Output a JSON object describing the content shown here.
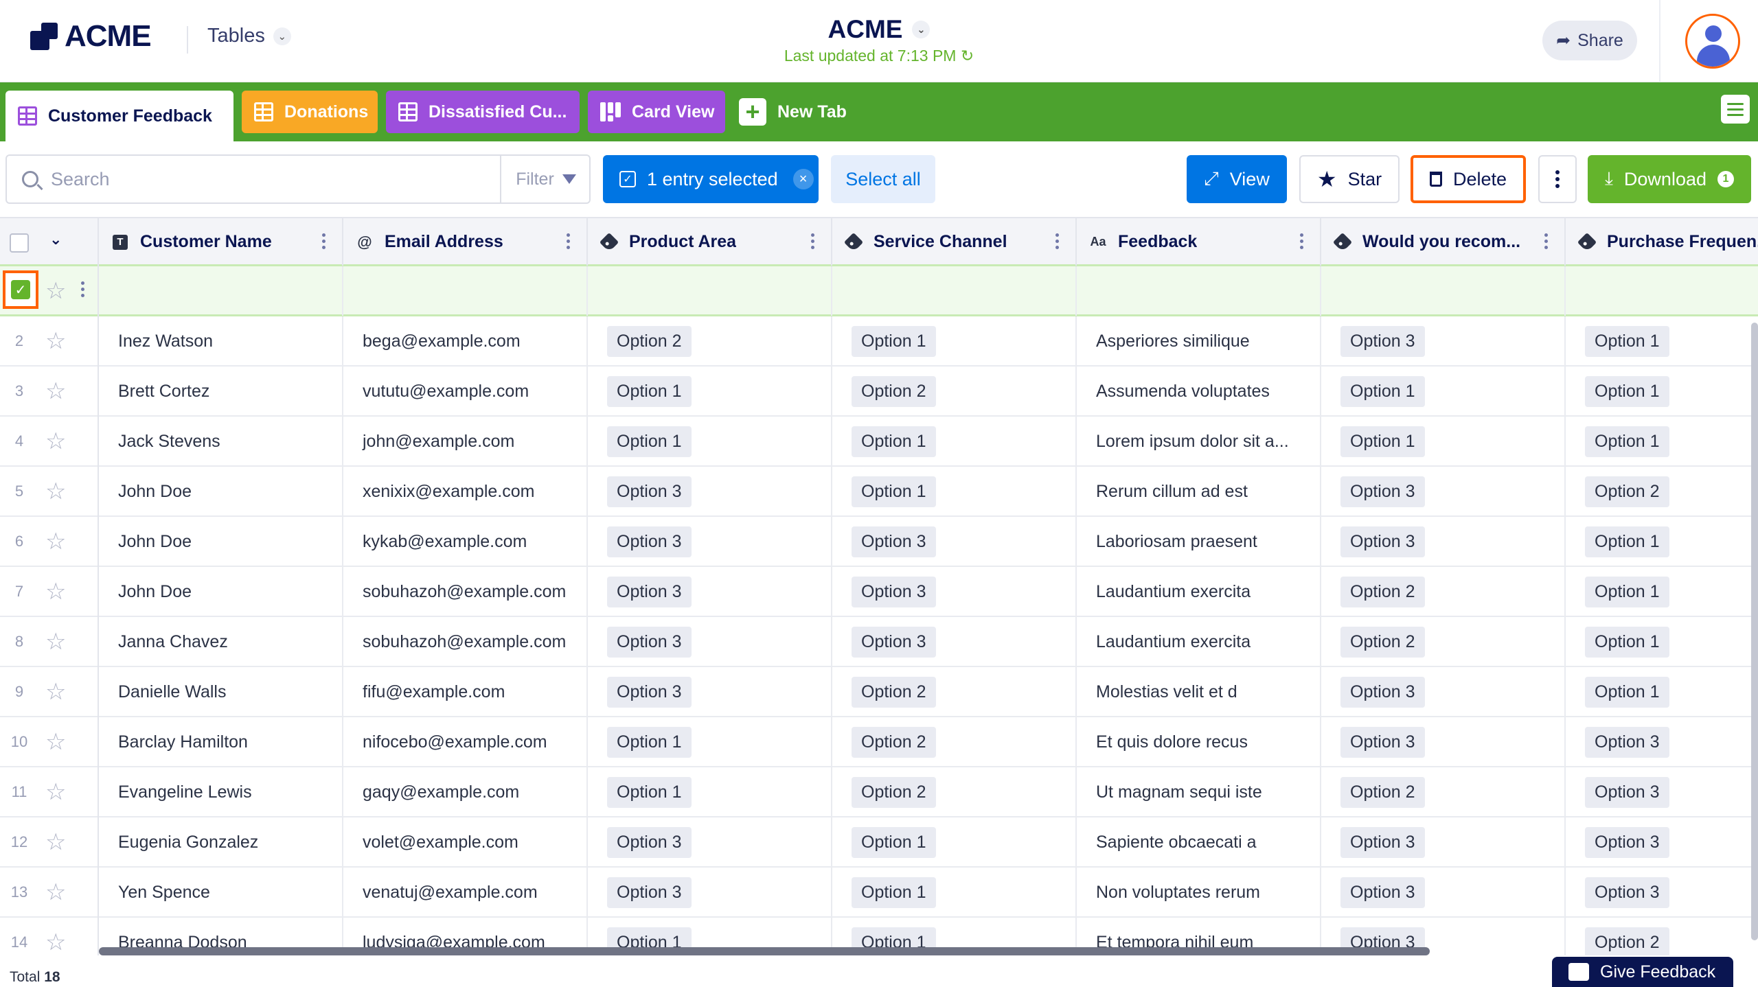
{
  "header": {
    "logo_text": "ACME",
    "tables_label": "Tables",
    "app_title": "ACME",
    "last_updated": "Last updated at 7:13 PM",
    "share_label": "Share"
  },
  "tabs": [
    {
      "label": "Customer Feedback",
      "icon": "grid-icon",
      "color": "#ffffff",
      "active": true
    },
    {
      "label": "Donations",
      "icon": "grid-icon",
      "color": "#f9a825"
    },
    {
      "label": "Dissatisfied Cu...",
      "icon": "grid-icon",
      "color": "#9c4fdc"
    },
    {
      "label": "Card View",
      "icon": "card-view-icon",
      "color": "#9c4fdc"
    },
    {
      "label": "New Tab",
      "icon": "plus-icon"
    }
  ],
  "toolbar": {
    "search_placeholder": "Search",
    "filter_label": "Filter",
    "selected_label": "1 entry selected",
    "select_all_label": "Select all",
    "view_label": "View",
    "star_label": "Star",
    "delete_label": "Delete",
    "download_label": "Download",
    "download_badge": "1"
  },
  "columns": [
    {
      "label": "Customer Name",
      "icon": "text-type-icon"
    },
    {
      "label": "Email Address",
      "icon": "at-icon"
    },
    {
      "label": "Product Area",
      "icon": "tag-icon"
    },
    {
      "label": "Service Channel",
      "icon": "tag-icon"
    },
    {
      "label": "Feedback",
      "icon": "aa-text-icon"
    },
    {
      "label": "Would you recom...",
      "icon": "tag-icon"
    },
    {
      "label": "Purchase Frequen...",
      "icon": "tag-icon"
    }
  ],
  "rows": [
    {
      "num": "2",
      "name": "Inez Watson",
      "email": "bega@example.com",
      "product": "Option 2",
      "channel": "Option 1",
      "feedback": "Asperiores similique",
      "recommend": "Option 3",
      "frequency": "Option 1"
    },
    {
      "num": "3",
      "name": "Brett Cortez",
      "email": "vututu@example.com",
      "product": "Option 1",
      "channel": "Option 2",
      "feedback": "Assumenda voluptates",
      "recommend": "Option 1",
      "frequency": "Option 1"
    },
    {
      "num": "4",
      "name": "Jack Stevens",
      "email": "john@example.com",
      "product": "Option 1",
      "channel": "Option 1",
      "feedback": "Lorem ipsum dolor sit a...",
      "recommend": "Option 1",
      "frequency": "Option 1"
    },
    {
      "num": "5",
      "name": "John Doe",
      "email": "xenixix@example.com",
      "product": "Option 3",
      "channel": "Option 1",
      "feedback": "Rerum cillum ad est",
      "recommend": "Option 3",
      "frequency": "Option 2"
    },
    {
      "num": "6",
      "name": "John Doe",
      "email": "kykab@example.com",
      "product": "Option 3",
      "channel": "Option 3",
      "feedback": "Laboriosam praesent",
      "recommend": "Option 3",
      "frequency": "Option 1"
    },
    {
      "num": "7",
      "name": "John Doe",
      "email": "sobuhazoh@example.com",
      "product": "Option 3",
      "channel": "Option 3",
      "feedback": "Laudantium exercita",
      "recommend": "Option 2",
      "frequency": "Option 1"
    },
    {
      "num": "8",
      "name": "Janna Chavez",
      "email": "sobuhazoh@example.com",
      "product": "Option 3",
      "channel": "Option 3",
      "feedback": "Laudantium exercita",
      "recommend": "Option 2",
      "frequency": "Option 1"
    },
    {
      "num": "9",
      "name": "Danielle Walls",
      "email": "fifu@example.com",
      "product": "Option 3",
      "channel": "Option 2",
      "feedback": "Molestias velit et d",
      "recommend": "Option 3",
      "frequency": "Option 1"
    },
    {
      "num": "10",
      "name": "Barclay Hamilton",
      "email": "nifocebo@example.com",
      "product": "Option 1",
      "channel": "Option 2",
      "feedback": "Et quis dolore recus",
      "recommend": "Option 3",
      "frequency": "Option 3"
    },
    {
      "num": "11",
      "name": "Evangeline Lewis",
      "email": "gaqy@example.com",
      "product": "Option 1",
      "channel": "Option 2",
      "feedback": "Ut magnam sequi iste",
      "recommend": "Option 2",
      "frequency": "Option 3"
    },
    {
      "num": "12",
      "name": "Eugenia Gonzalez",
      "email": "volet@example.com",
      "product": "Option 3",
      "channel": "Option 1",
      "feedback": "Sapiente obcaecati a",
      "recommend": "Option 3",
      "frequency": "Option 3"
    },
    {
      "num": "13",
      "name": "Yen Spence",
      "email": "venatuj@example.com",
      "product": "Option 3",
      "channel": "Option 1",
      "feedback": "Non voluptates rerum",
      "recommend": "Option 3",
      "frequency": "Option 3"
    },
    {
      "num": "14",
      "name": "Breanna Dodson",
      "email": "ludysiga@example.com",
      "product": "Option 1",
      "channel": "Option 1",
      "feedback": "Et tempora nihil eum",
      "recommend": "Option 3",
      "frequency": "Option 2"
    }
  ],
  "footer": {
    "total_label": "Total",
    "total_count": "18",
    "give_feedback_label": "Give Feedback"
  },
  "colors": {
    "brand_navy": "#0a1551",
    "tabbar_green": "#4ca22e",
    "primary_blue": "#0075e3",
    "download_green": "#64b42c",
    "highlight_orange": "#ff6100"
  }
}
